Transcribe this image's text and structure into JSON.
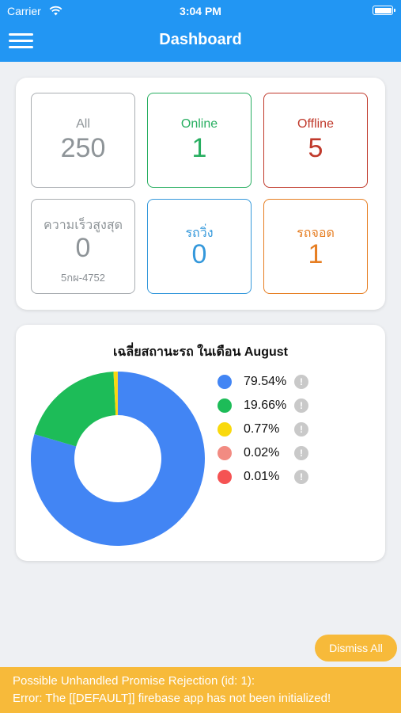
{
  "status_bar": {
    "carrier": "Carrier",
    "time": "3:04 PM"
  },
  "header": {
    "title": "Dashboard",
    "color": "#2296f3"
  },
  "stats": {
    "all": {
      "label": "All",
      "value": "250",
      "color": "#8e9498"
    },
    "online": {
      "label": "Online",
      "value": "1",
      "color": "#27ae60"
    },
    "offline": {
      "label": "Offline",
      "value": "5",
      "color": "#c0392b"
    },
    "max_speed": {
      "label": "ความเร็วสูงสุด",
      "value": "0",
      "plate": "5กผ-4752",
      "color": "#8e9498"
    },
    "running": {
      "label": "รถวิ่ง",
      "value": "0",
      "color": "#3498db"
    },
    "parked": {
      "label": "รถจอด",
      "value": "1",
      "color": "#e67e22"
    }
  },
  "chart_data": {
    "type": "pie",
    "title": "เฉลี่ยสถานะรถ ในเดือน August",
    "values": [
      79.54,
      19.66,
      0.77,
      0.02,
      0.01
    ],
    "labels": [
      "79.54%",
      "19.66%",
      "0.77%",
      "0.02%",
      "0.01%"
    ],
    "colors": [
      "#4285f4",
      "#1dbc58",
      "#f9d90d",
      "#f28b82",
      "#f55353"
    ],
    "legend": "right",
    "info_icon": "!"
  },
  "dismiss_label": "Dismiss All",
  "error": {
    "line1": "Possible Unhandled Promise Rejection (id: 1):",
    "line2": "Error: The [[DEFAULT]] firebase app has not been initialized!"
  },
  "icons": [
    "wifi-icon",
    "battery-icon",
    "hamburger-menu-icon",
    "info-icon"
  ]
}
